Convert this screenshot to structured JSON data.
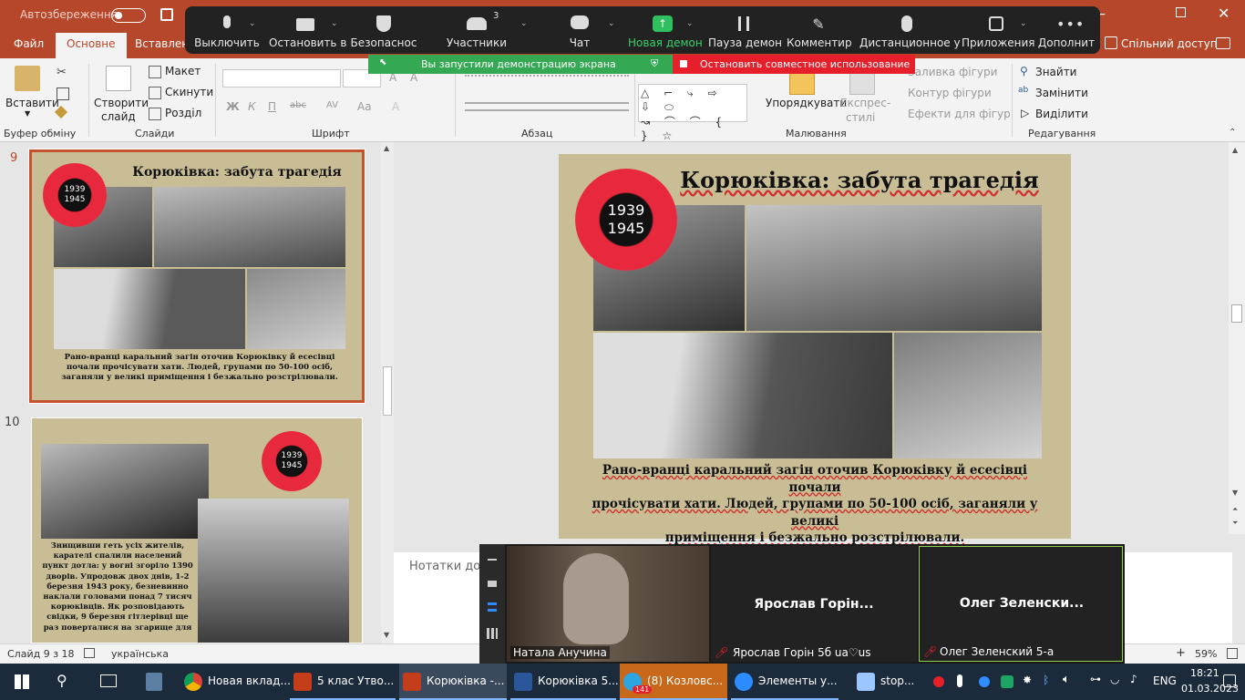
{
  "titlebar": {
    "autosave_label": "Автозбереження",
    "autosave_state": "Вимк",
    "share_label": "Спільний доступ"
  },
  "tabs": [
    "Файл",
    "Основне",
    "Вставлення"
  ],
  "active_tab": "Основне",
  "zoom": {
    "buttons": [
      {
        "id": "mute",
        "label": "Выключить",
        "icon": "microphone-icon"
      },
      {
        "id": "video",
        "label": "Остановить в",
        "icon": "camera-icon"
      },
      {
        "id": "security",
        "label": "Безопаснос",
        "icon": "shield-icon"
      },
      {
        "id": "participants",
        "label": "Участники",
        "icon": "people-icon",
        "count": "3"
      },
      {
        "id": "chat",
        "label": "Чат",
        "icon": "chat-bubble-icon"
      },
      {
        "id": "newshare",
        "label": "Новая демон",
        "icon": "share-up-arrow-icon"
      },
      {
        "id": "pause",
        "label": "Пауза демон",
        "icon": "pause-icon"
      },
      {
        "id": "annotate",
        "label": "Комментир",
        "icon": "pencil-icon"
      },
      {
        "id": "remote",
        "label": "Дистанционное у",
        "icon": "mouse-icon"
      },
      {
        "id": "apps",
        "label": "Приложения",
        "icon": "apps-icon"
      },
      {
        "id": "more",
        "label": "Дополнит",
        "icon": "more-dots-icon"
      }
    ],
    "sharing_text": "Вы запустили демонстрацию экрана",
    "stop_text": "Остановить совместное использование",
    "green": "#34a853",
    "red": "#e5202a"
  },
  "ribbon": {
    "clipboard": {
      "paste": "Вставити",
      "group": "Буфер обміну"
    },
    "slides": {
      "new": "Створити",
      "new2": "слайд",
      "layout": "Макет",
      "reset": "Скинути",
      "section": "Розділ",
      "group": "Слайди"
    },
    "font": {
      "group": "Шрифт",
      "bold": "Ж",
      "italic": "К",
      "underline": "П",
      "strike": "abc",
      "spacing": "AV",
      "case": "Aa"
    },
    "paragraph": {
      "group": "Абзац"
    },
    "drawing": {
      "arrange": "Упорядкувати",
      "quick": "Експрес-",
      "quick2": "стилі",
      "fill": "Заливка фігури",
      "outline": "Контур фігури",
      "effects": "Ефекти для фігур",
      "group": "Малювання"
    },
    "editing": {
      "find": "Знайти",
      "replace": "Замінити",
      "select": "Виділити",
      "group": "Редагування"
    }
  },
  "slides": [
    {
      "num": "9",
      "title": "Корюківка: забута трагедія",
      "caption": "Рано-вранці каральний загін оточив Корюківку й есесівці почали прочісувати хати. Людей, групами по 50-100 осіб, заганяли у великі приміщення і безжально розстрілювали."
    },
    {
      "num": "10",
      "caption": "Знищивши геть усіх жителів, карателі спалили населений пункт дотла: у вогні згоріло 1390 дворів.  Упродовж двох днів, 1-2 березня 1943 року, безневинно наклали головами понад 7 тисяч корюківців. Як розповідають свідки, 9 березня гітлерівці ще раз поверталися на згарище для"
    }
  ],
  "poppy": {
    "y1": "1939",
    "y2": "1945"
  },
  "main_slide": {
    "title": "Корюківка: забута трагедія",
    "caption_l1": "Рано-вранці каральний загін оточив Корюківку й есесівці почали",
    "caption_l2": "прочісувати хати. Людей, групами по 50-100 осіб, заганяли у великі",
    "caption_l3": "приміщення і безжально розстрілювали."
  },
  "notes_placeholder": "Нотатки до",
  "status": {
    "slide": "Слайд 9 з 18",
    "lang": "українська",
    "zoom": "59%"
  },
  "video": [
    {
      "name": "Натала Анучина",
      "has_video": true
    },
    {
      "title": "Ярослав  Горін...",
      "name": "Ярослав Горін 5б ua♡us",
      "muted": true
    },
    {
      "title": "Олег  Зеленски...",
      "name": "Олег Зеленский 5-а",
      "muted": true
    }
  ],
  "taskbar": {
    "items": [
      {
        "label": "Новая вклад...",
        "icon": "chrome-icon",
        "color": "#db4437"
      },
      {
        "label": "5 клас Утво...",
        "icon": "powerpoint-icon",
        "color": "#c43e1c"
      },
      {
        "label": "Корюківка -...",
        "icon": "powerpoint-icon",
        "color": "#c43e1c"
      },
      {
        "label": "Корюківка 5...",
        "icon": "word-icon",
        "color": "#2b579a"
      },
      {
        "label": "(8) Козловс...",
        "icon": "telegram-icon",
        "color": "#2ca5e0",
        "badge": "141"
      },
      {
        "label": "Элементы у...",
        "icon": "zoom-icon",
        "color": "#2d8cff"
      },
      {
        "label": "stop...",
        "icon": "zoom-share-icon",
        "color": "#2d8cff"
      }
    ],
    "lang": "ENG",
    "time": "18:21",
    "date": "01.03.2023"
  }
}
